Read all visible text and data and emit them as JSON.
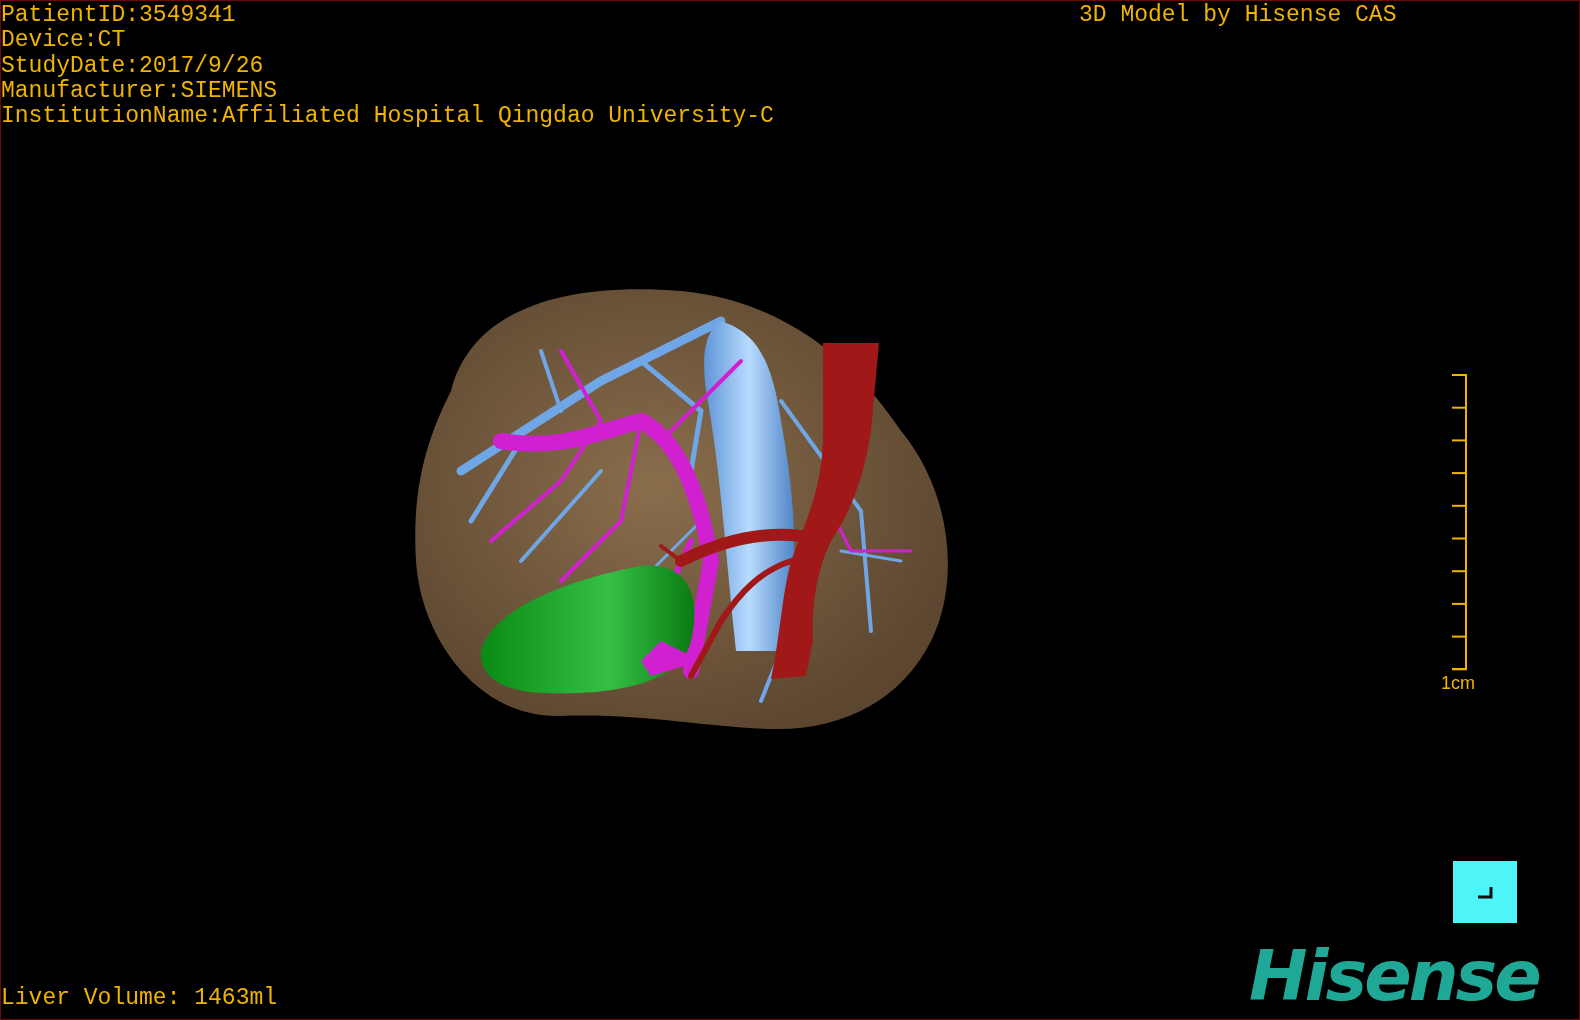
{
  "study_info": [
    "PatientID:3549341",
    "Device:CT",
    "StudyDate:2017/9/26",
    "Manufacturer:SIEMENS",
    "InstitutionName:Affiliated Hospital Qingdao University-C"
  ],
  "header": {
    "title": "3D Model by Hisense CAS"
  },
  "scale_bar": {
    "label": "1cm"
  },
  "footer": {
    "liver_volume": "Liver Volume: 1463ml"
  },
  "logo": {
    "text": "Hisense"
  }
}
